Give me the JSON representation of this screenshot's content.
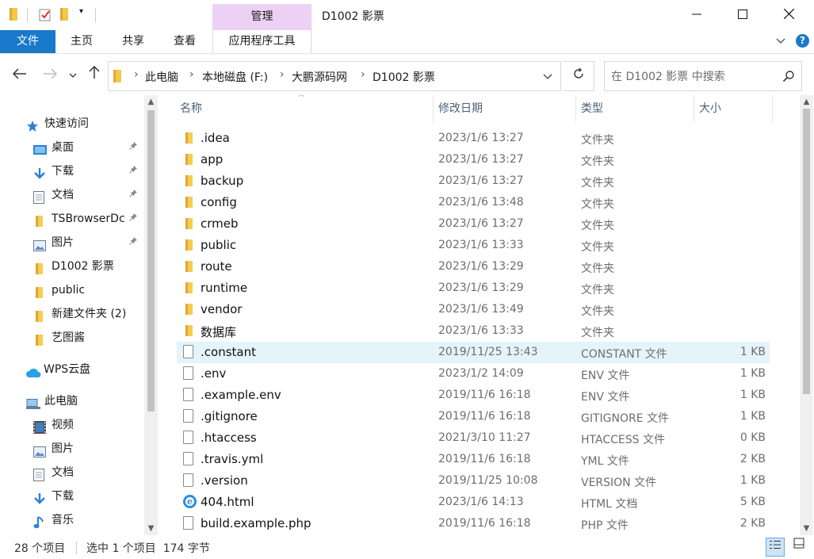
{
  "window": {
    "title": "D1002 影票",
    "context_tab_group": "管理",
    "minimize_icon": "minimize-icon",
    "maximize_icon": "maximize-icon",
    "close_icon": "close-icon"
  },
  "ribbon": {
    "tabs": [
      "文件",
      "主页",
      "共享",
      "查看",
      "应用程序工具"
    ],
    "file_tab_color": "#1979ca",
    "context_tab_color": "#ecd1f5"
  },
  "breadcrumb": [
    "此电脑",
    "本地磁盘 (F:)",
    "大鹏源码网",
    "D1002 影票"
  ],
  "search": {
    "placeholder": "在 D1002 影票 中搜索"
  },
  "nav_pane": {
    "items": [
      {
        "label": "快速访问",
        "icon": "star-icon",
        "pinned": false
      },
      {
        "label": "桌面",
        "icon": "desktop-icon",
        "pinned": true
      },
      {
        "label": "下载",
        "icon": "download-icon",
        "pinned": true
      },
      {
        "label": "文档",
        "icon": "document-icon",
        "pinned": true
      },
      {
        "label": "TSBrowserDc",
        "icon": "folder-icon",
        "pinned": true
      },
      {
        "label": "图片",
        "icon": "pictures-icon",
        "pinned": true
      },
      {
        "label": "D1002 影票",
        "icon": "folder-icon",
        "pinned": false
      },
      {
        "label": "public",
        "icon": "folder-icon",
        "pinned": false
      },
      {
        "label": "新建文件夹 (2)",
        "icon": "folder-icon",
        "pinned": false
      },
      {
        "label": "艺图酱",
        "icon": "folder-icon",
        "pinned": false
      },
      {
        "label": "WPS云盘",
        "icon": "cloud-icon",
        "pinned": false
      },
      {
        "label": "此电脑",
        "icon": "computer-icon",
        "pinned": false
      },
      {
        "label": "视频",
        "icon": "video-icon",
        "pinned": false
      },
      {
        "label": "图片",
        "icon": "pictures-icon",
        "pinned": false
      },
      {
        "label": "文档",
        "icon": "document-icon",
        "pinned": false
      },
      {
        "label": "下载",
        "icon": "download-icon",
        "pinned": false
      },
      {
        "label": "音乐",
        "icon": "music-icon",
        "pinned": false
      }
    ]
  },
  "file_list": {
    "columns": {
      "name": "名称",
      "date": "修改日期",
      "type": "类型",
      "size": "大小"
    },
    "files": [
      {
        "name": ".idea",
        "date": "2023/1/6 13:27",
        "type": "文件夹",
        "size": "",
        "icon": "folder-icon"
      },
      {
        "name": "app",
        "date": "2023/1/6 13:27",
        "type": "文件夹",
        "size": "",
        "icon": "folder-icon"
      },
      {
        "name": "backup",
        "date": "2023/1/6 13:27",
        "type": "文件夹",
        "size": "",
        "icon": "folder-icon"
      },
      {
        "name": "config",
        "date": "2023/1/6 13:48",
        "type": "文件夹",
        "size": "",
        "icon": "folder-icon"
      },
      {
        "name": "crmeb",
        "date": "2023/1/6 13:27",
        "type": "文件夹",
        "size": "",
        "icon": "folder-icon"
      },
      {
        "name": "public",
        "date": "2023/1/6 13:33",
        "type": "文件夹",
        "size": "",
        "icon": "folder-icon"
      },
      {
        "name": "route",
        "date": "2023/1/6 13:29",
        "type": "文件夹",
        "size": "",
        "icon": "folder-icon"
      },
      {
        "name": "runtime",
        "date": "2023/1/6 13:29",
        "type": "文件夹",
        "size": "",
        "icon": "folder-icon"
      },
      {
        "name": "vendor",
        "date": "2023/1/6 13:49",
        "type": "文件夹",
        "size": "",
        "icon": "folder-icon"
      },
      {
        "name": "数据库",
        "date": "2023/1/6 13:33",
        "type": "文件夹",
        "size": "",
        "icon": "folder-icon"
      },
      {
        "name": ".constant",
        "date": "2019/11/25 13:43",
        "type": "CONSTANT 文件",
        "size": "1 KB",
        "icon": "file-icon",
        "selected": true
      },
      {
        "name": ".env",
        "date": "2023/1/2 14:09",
        "type": "ENV 文件",
        "size": "1 KB",
        "icon": "file-icon"
      },
      {
        "name": ".example.env",
        "date": "2019/11/6 16:18",
        "type": "ENV 文件",
        "size": "1 KB",
        "icon": "file-icon"
      },
      {
        "name": ".gitignore",
        "date": "2019/11/6 16:18",
        "type": "GITIGNORE 文件",
        "size": "1 KB",
        "icon": "file-icon"
      },
      {
        "name": ".htaccess",
        "date": "2021/3/10 11:27",
        "type": "HTACCESS 文件",
        "size": "0 KB",
        "icon": "file-icon"
      },
      {
        "name": ".travis.yml",
        "date": "2019/11/6 16:18",
        "type": "YML 文件",
        "size": "2 KB",
        "icon": "file-icon"
      },
      {
        "name": ".version",
        "date": "2019/11/25 10:08",
        "type": "VERSION 文件",
        "size": "1 KB",
        "icon": "file-icon"
      },
      {
        "name": "404.html",
        "date": "2023/1/6 14:13",
        "type": "HTML 文档",
        "size": "5 KB",
        "icon": "ie-icon"
      },
      {
        "name": "build.example.php",
        "date": "2019/11/6 16:18",
        "type": "PHP 文件",
        "size": "2 KB",
        "icon": "file-icon"
      }
    ]
  },
  "status_bar": {
    "item_count": "28 个项目",
    "selection": "选中 1 个项目  174 字节"
  }
}
